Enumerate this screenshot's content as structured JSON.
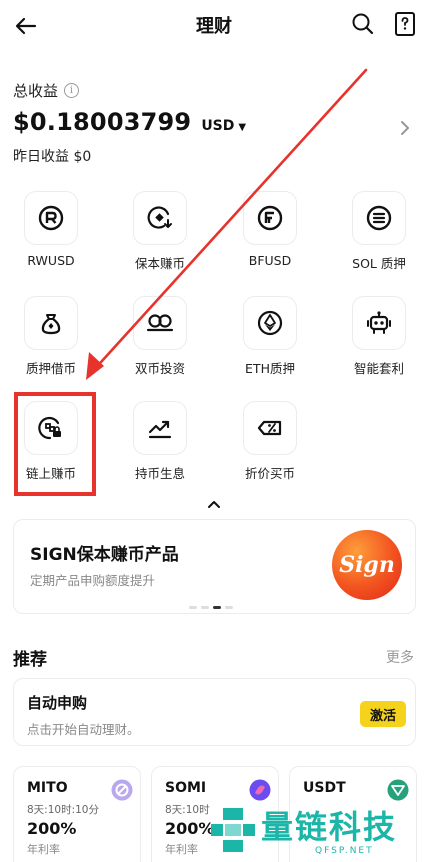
{
  "header": {
    "title": "理财"
  },
  "earnings": {
    "label": "总收益",
    "total": "$0.18003799",
    "currency": "USD",
    "yesterday": "昨日收益 $0"
  },
  "grid": [
    {
      "label": "RWUSD",
      "icon": "rwusd-icon"
    },
    {
      "label": "保本赚币",
      "icon": "principal-protected-icon"
    },
    {
      "label": "BFUSD",
      "icon": "bfusd-icon"
    },
    {
      "label": "SOL 质押",
      "icon": "sol-staking-icon"
    },
    {
      "label": "质押借币",
      "icon": "loan-bag-icon"
    },
    {
      "label": "双币投资",
      "icon": "dual-coin-icon"
    },
    {
      "label": "ETH质押",
      "icon": "eth-icon"
    },
    {
      "label": "智能套利",
      "icon": "robot-icon"
    },
    {
      "label": "链上赚币",
      "icon": "onchain-icon"
    },
    {
      "label": "持币生息",
      "icon": "trend-icon"
    },
    {
      "label": "折价买币",
      "icon": "discount-tag-icon"
    }
  ],
  "banner": {
    "title": "SIGN保本赚币产品",
    "subtitle": "定期产品申购额度提升",
    "logo_text": "Sign"
  },
  "recommend": {
    "title": "推荐",
    "more": "更多"
  },
  "auto_subscribe": {
    "title": "自动申购",
    "subtitle": "点击开始自动理财。",
    "button": "激活"
  },
  "products": [
    {
      "name": "MITO",
      "term": "8天:10时:10分",
      "rate": "200%",
      "rate_label": "年利率",
      "color": "#b7a8f0"
    },
    {
      "name": "SOMI",
      "term": "8天:10时",
      "rate": "200%",
      "rate_label": "年利率",
      "color": "#6a4cf0"
    },
    {
      "name": "USDT",
      "term": "",
      "rate": "",
      "rate_label": "",
      "color": "#26a17b"
    }
  ],
  "watermark": {
    "text": "量链科技",
    "url": "QFSP.NET"
  },
  "colors": {
    "accent": "#f5d21c",
    "highlight": "#e8322c",
    "arrow": "#e8322c"
  }
}
